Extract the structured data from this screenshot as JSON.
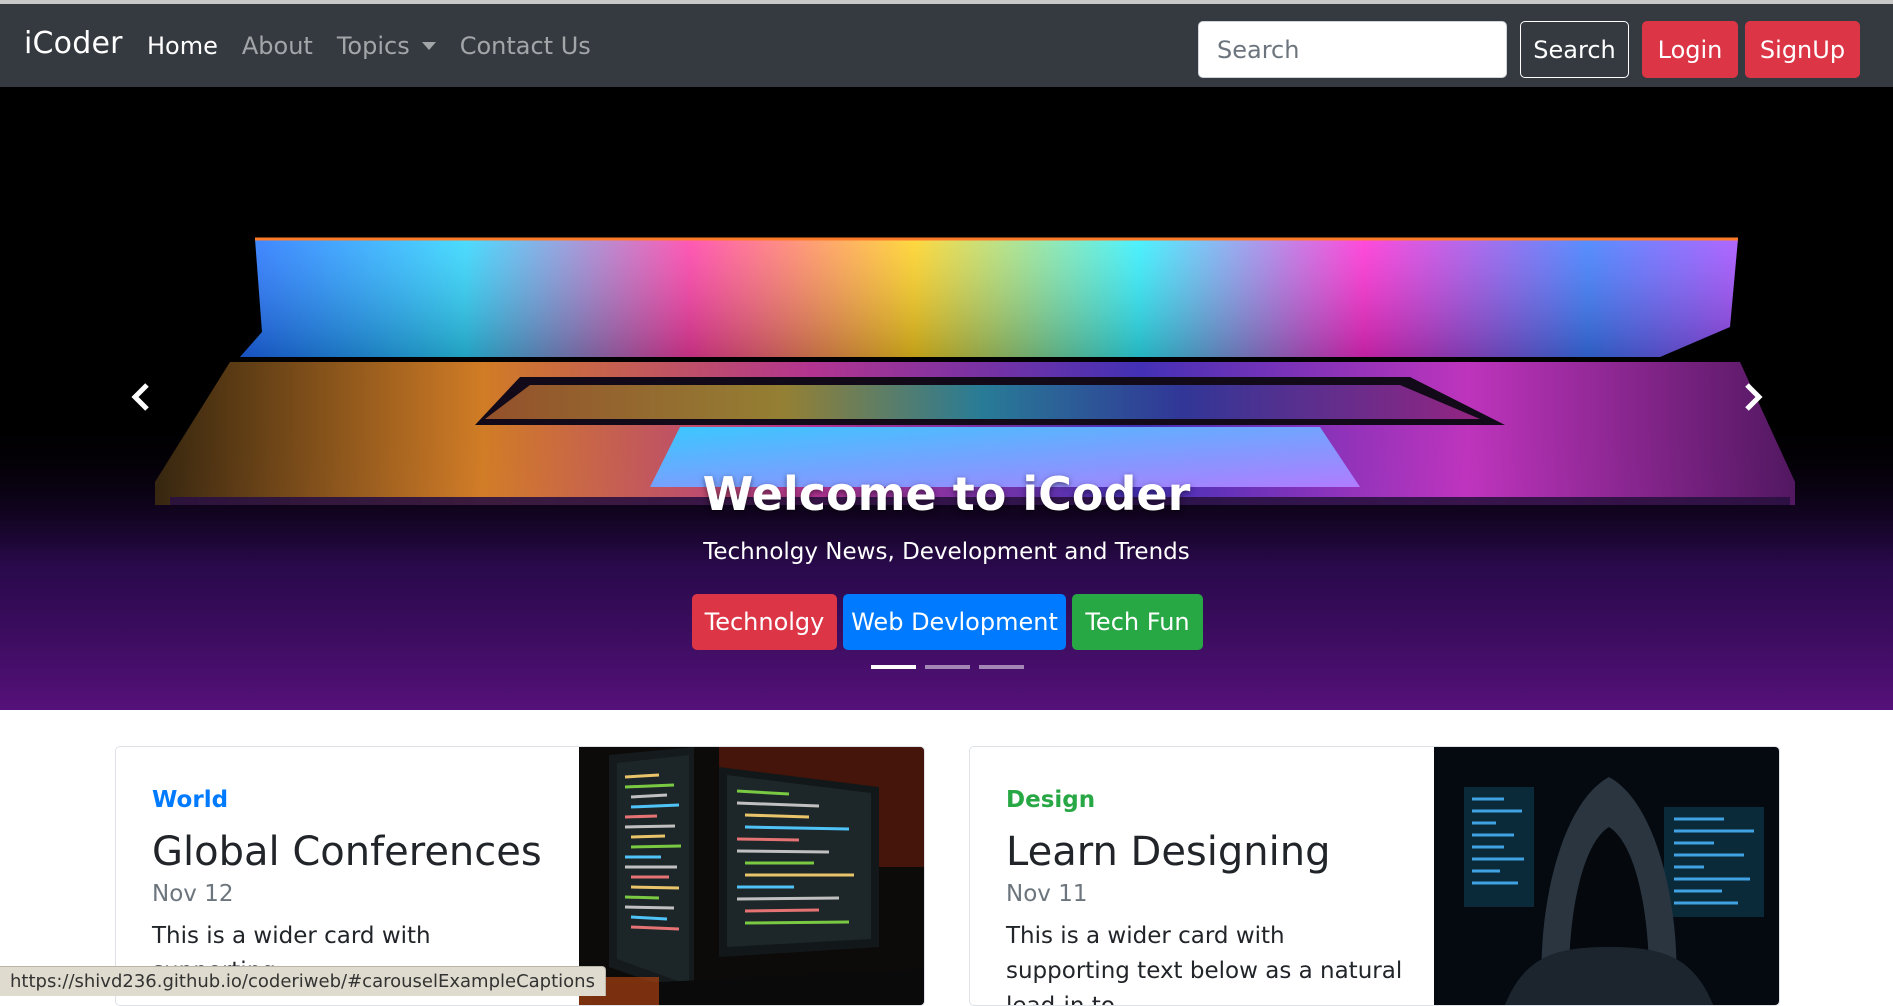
{
  "navbar": {
    "brand": "iCoder",
    "links": [
      {
        "label": "Home",
        "active": true
      },
      {
        "label": "About",
        "active": false
      },
      {
        "label": "Topics",
        "active": false,
        "dropdown": true
      },
      {
        "label": "Contact Us",
        "active": false
      }
    ],
    "search_placeholder": "Search",
    "search_button": "Search",
    "login_button": "Login",
    "signup_button": "SignUp"
  },
  "carousel": {
    "title": "Welcome to iCoder",
    "subtitle": "Technolgy News, Development and Trends",
    "buttons": [
      "Technolgy",
      "Web Devlopment",
      "Tech Fun"
    ],
    "active_slide": 1,
    "slide_count": 3,
    "prev_icon": "chevron-left-icon",
    "next_icon": "chevron-right-icon"
  },
  "cards": [
    {
      "category": "World",
      "title": "Global Conferences",
      "date": "Nov 12",
      "text": "This is a wider card with supporting"
    },
    {
      "category": "Design",
      "title": "Learn Designing",
      "date": "Nov 11",
      "text": "This is a wider card with supporting text below as a natural lead-in to"
    }
  ],
  "status_url": "https://shivd236.github.io/coderiweb/#carouselExampleCaptions",
  "colors": {
    "navbar": "#343a40",
    "danger": "#dc3545",
    "primary": "#007bff",
    "success": "#28a745"
  }
}
